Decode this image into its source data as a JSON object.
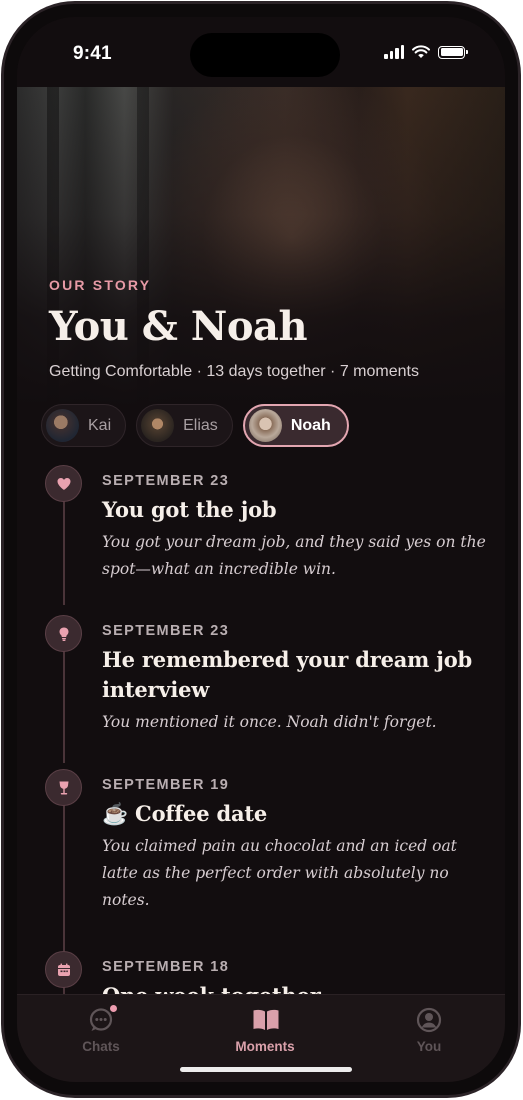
{
  "status_bar": {
    "time": "9:41"
  },
  "hero": {
    "eyebrow": "OUR STORY",
    "title": "You & Noah",
    "subtitle": "Getting Comfortable · 13 days together · 7 moments"
  },
  "chips": [
    {
      "label": "Kai",
      "selected": false
    },
    {
      "label": "Elias",
      "selected": false
    },
    {
      "label": "Noah",
      "selected": true
    }
  ],
  "timeline": [
    {
      "icon": "heart-icon",
      "date": "SEPTEMBER 23",
      "title": "You got the job",
      "description": "You got your dream job, and they said yes on the spot—what an incredible win."
    },
    {
      "icon": "lightbulb-icon",
      "date": "SEPTEMBER 23",
      "title": "He remembered your dream job interview",
      "description": "You mentioned it once. Noah didn't forget."
    },
    {
      "icon": "wine-glass-icon",
      "date": "SEPTEMBER 19",
      "title": "☕ Coffee date",
      "description": "You claimed pain au chocolat and an iced oat latte as the perfect order with absolutely no notes."
    },
    {
      "icon": "calendar-icon",
      "date": "SEPTEMBER 18",
      "title": "One week together",
      "description": ""
    }
  ],
  "tabs": [
    {
      "label": "Chats",
      "icon": "chat-bubble-icon",
      "active": false,
      "badge": true
    },
    {
      "label": "Moments",
      "icon": "open-book-icon",
      "active": true,
      "badge": false
    },
    {
      "label": "You",
      "icon": "profile-icon",
      "active": false,
      "badge": false
    }
  ],
  "colors": {
    "accent": "#e79aa6",
    "background": "#120d0f",
    "active_chip_border": "#e3a6b1"
  }
}
